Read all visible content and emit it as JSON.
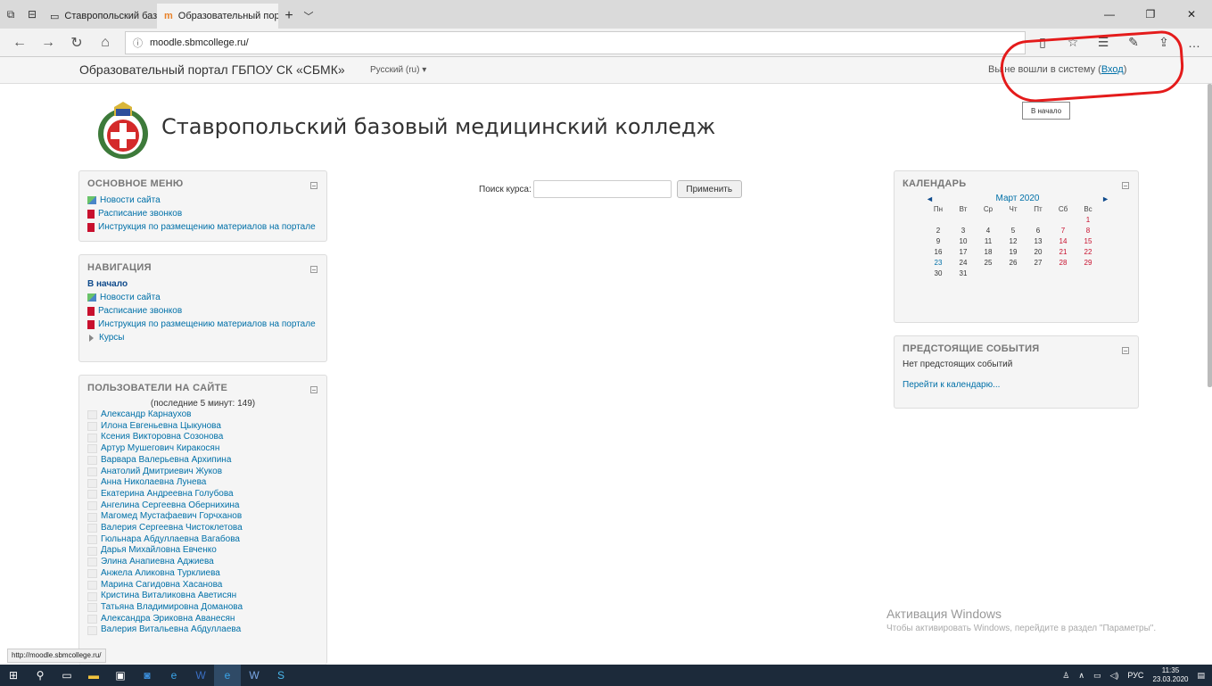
{
  "browser": {
    "tabs": [
      {
        "title": "Ставропольский базовый ::",
        "active": false
      },
      {
        "title": "Образовательный пор",
        "active": true
      }
    ],
    "url": "moodle.sbmcollege.ru/",
    "status_url": "http://moodle.sbmcollege.ru/"
  },
  "topbar": {
    "site_name": "Образовательный портал ГБПОУ СК «СБМК»",
    "language": "Русский (ru) ▾",
    "login_text": "Вы не вошли в систему (",
    "login_link": "Вход",
    "login_close": ")"
  },
  "tooltip": "В начало",
  "header": {
    "title": "Ставропольский базовый медицинский колледж"
  },
  "main_menu": {
    "title": "ОСНОВНОЕ МЕНЮ",
    "items": [
      "Новости сайта",
      "Расписание звонков",
      "Инструкция по размещению материалов на портале"
    ]
  },
  "navigation": {
    "title": "НАВИГАЦИЯ",
    "home": "В начало",
    "items": [
      "Новости сайта",
      "Расписание звонков",
      "Инструкция по размещению материалов на портале"
    ],
    "courses": "Курсы"
  },
  "online_users": {
    "title": "ПОЛЬЗОВАТЕЛИ НА САЙТЕ",
    "subtitle": "(последние 5 минут: 149)",
    "users": [
      "Александр Карнаухов",
      "Илона Евгеньевна Цыкунова",
      "Ксения Викторовна Созонова",
      "Артур Мушегович Киракосян",
      "Варвара Валерьевна Архипина",
      "Анатолий Дмитриевич Жуков",
      "Анна Николаевна Лунева",
      "Екатерина Андреевна Голубова",
      "Ангелина Сергеевна Обернихина",
      "Магомед Мустафаевич Горчханов",
      "Валерия Сергеевна Чистоклетова",
      "Гюльнара Абдуллаевна Вагабова",
      "Дарья Михайловна Евченко",
      "Элина Анапиевна Аджиева",
      "Анжела Аликовна Турклиева",
      "Марина Сагидовна Хасанова",
      "Кристина Виталиковна Аветисян",
      "Татьяна Владимировна Доманова",
      "Александра Эриковна Аванесян",
      "Валерия Витальевна Абдуллаева"
    ]
  },
  "search": {
    "label": "Поиск курса:",
    "value": "",
    "button": "Применить"
  },
  "calendar": {
    "title": "КАЛЕНДАРЬ",
    "month": "Март 2020",
    "prev": "◄",
    "next": "►",
    "weekdays": [
      "Пн",
      "Вт",
      "Ср",
      "Чт",
      "Пт",
      "Сб",
      "Вс"
    ],
    "weeks": [
      [
        "",
        "",
        "",
        "",
        "",
        "",
        "1"
      ],
      [
        "2",
        "3",
        "4",
        "5",
        "6",
        "7",
        "8"
      ],
      [
        "9",
        "10",
        "11",
        "12",
        "13",
        "14",
        "15"
      ],
      [
        "16",
        "17",
        "18",
        "19",
        "20",
        "21",
        "22"
      ],
      [
        "23",
        "24",
        "25",
        "26",
        "27",
        "28",
        "29"
      ],
      [
        "30",
        "31",
        "",
        "",
        "",
        "",
        ""
      ]
    ],
    "today": "23"
  },
  "upcoming": {
    "title": "ПРЕДСТОЯЩИЕ СОБЫТИЯ",
    "none_text": "Нет предстоящих событий",
    "link": "Перейти к календарю..."
  },
  "watermark": {
    "line1": "Активация Windows",
    "line2": "Чтобы активировать Windows, перейдите в раздел \"Параметры\"."
  },
  "taskbar": {
    "lang": "РУС",
    "time": "11:35",
    "date": "23.03.2020"
  },
  "colors": {
    "link": "#0070a8",
    "annotation": "#e41b1b",
    "weekend": "#c8102e"
  }
}
